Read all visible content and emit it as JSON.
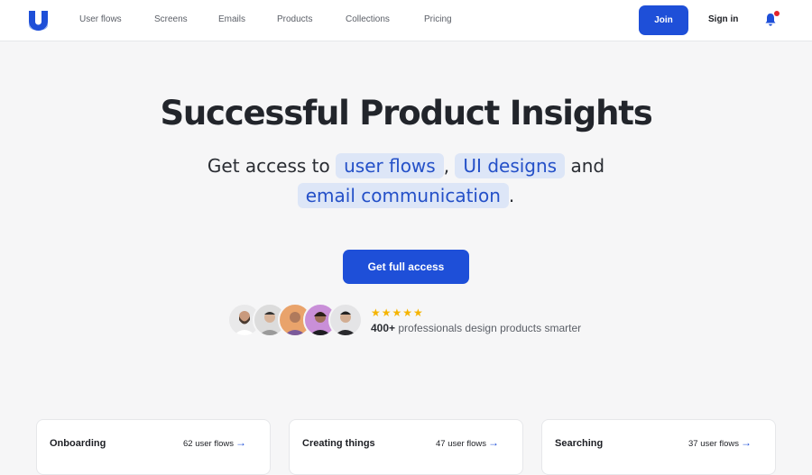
{
  "header": {
    "nav": [
      "User flows",
      "Screens",
      "Emails",
      "Products",
      "Collections",
      "Pricing"
    ],
    "join_label": "Join",
    "signin_label": "Sign in"
  },
  "hero": {
    "title": "Successful Product Insights",
    "sub_prefix": "Get access to",
    "chip1": "user flows",
    "comma": ",",
    "chip2": "UI designs",
    "and": "and",
    "chip3": "email communication",
    "period": ".",
    "cta_label": "Get full access",
    "stars": "★★★★★",
    "proof_count": "400+",
    "proof_text": "professionals design products smarter"
  },
  "cards": [
    {
      "title": "Onboarding",
      "count": "62 user flows"
    },
    {
      "title": "Creating things",
      "count": "47 user flows"
    },
    {
      "title": "Searching",
      "count": "37 user flows"
    }
  ],
  "colors": {
    "accent": "#1e4fd8",
    "chip_bg": "#dde6f7",
    "chip_text": "#2450c8",
    "star": "#f5b400",
    "notification_dot": "#e2232b"
  }
}
